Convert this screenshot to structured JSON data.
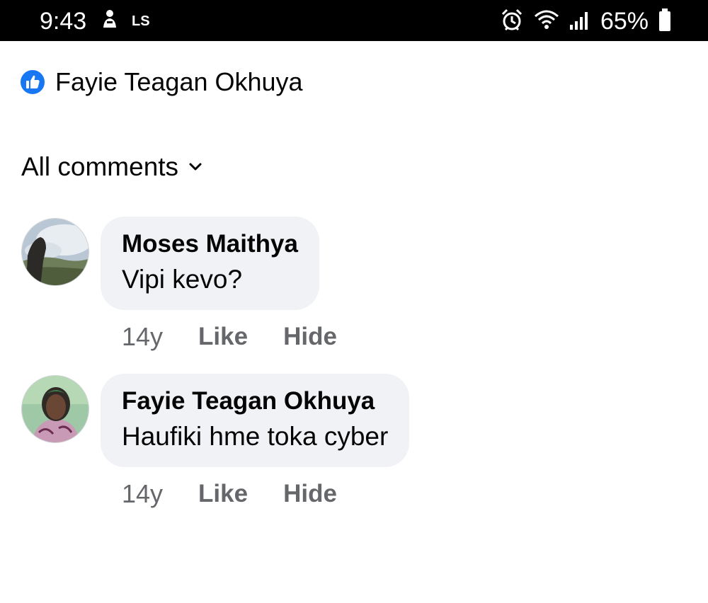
{
  "status_bar": {
    "time": "9:43",
    "left_icons": [
      "notification-icon",
      "ls-icon"
    ],
    "ls_text": "LS",
    "right_icons": [
      "alarm-icon",
      "wifi-icon",
      "signal-icon",
      "battery-icon"
    ],
    "battery": "65%"
  },
  "reactions": {
    "icon": "like-icon",
    "name": "Fayie Teagan Okhuya",
    "color": "#1877f2"
  },
  "filter": {
    "label": "All comments",
    "icon": "chevron-down-icon"
  },
  "comments": [
    {
      "author": "Moses Maithya",
      "text": "Vipi kevo?",
      "time": "14y",
      "like_label": "Like",
      "hide_label": "Hide"
    },
    {
      "author": "Fayie Teagan Okhuya",
      "text": "Haufiki hme toka cyber",
      "time": "14y",
      "like_label": "Like",
      "hide_label": "Hide"
    }
  ],
  "colors": {
    "bubble": "#f0f2f5",
    "secondary_text": "#65676b",
    "primary_text": "#050505"
  }
}
